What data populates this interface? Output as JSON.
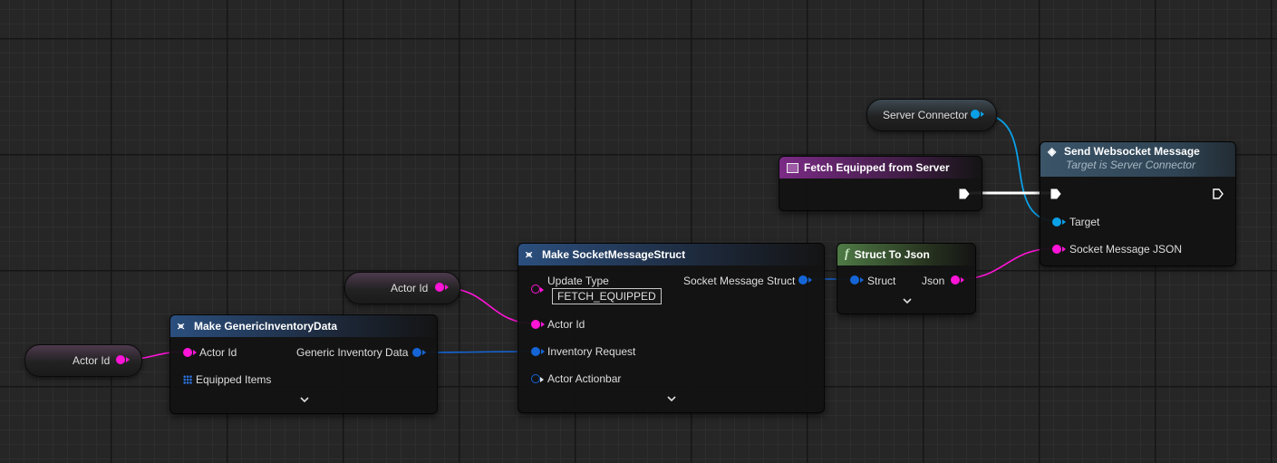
{
  "colors": {
    "string_pin": "#ff14d8",
    "struct_pin": "#1565d6",
    "object_pin": "#0b9fe6",
    "exec_pin": "#ffffff"
  },
  "getters": {
    "actor_id_left": {
      "label": "Actor Id",
      "icon": "string-pin-icon"
    },
    "actor_id_mid": {
      "label": "Actor Id",
      "icon": "string-pin-icon"
    },
    "server_connector": {
      "label": "Server Connector",
      "icon": "object-pin-icon"
    }
  },
  "make_inventory": {
    "title": "Make GenericInventoryData",
    "icon": "make-struct-icon",
    "inputs": [
      "Actor Id",
      "Equipped Items"
    ],
    "output": "Generic Inventory Data"
  },
  "make_socket": {
    "title": "Make SocketMessageStruct",
    "icon": "make-struct-icon",
    "inputs": [
      "Update Type",
      "Actor Id",
      "Inventory Request",
      "Actor Actionbar"
    ],
    "update_type_value": "FETCH_EQUIPPED",
    "output": "Socket Message Struct"
  },
  "struct_to_json": {
    "title": "Struct To Json",
    "icon": "function-f-icon",
    "input": "Struct",
    "output": "Json"
  },
  "fetch_event": {
    "title": "Fetch Equipped from Server",
    "icon": "custom-event-icon"
  },
  "send_message": {
    "title": "Send Websocket Message",
    "subtitle": "Target is Server Connector",
    "icon": "function-call-icon",
    "inputs": [
      "Target",
      "Socket Message JSON"
    ]
  }
}
